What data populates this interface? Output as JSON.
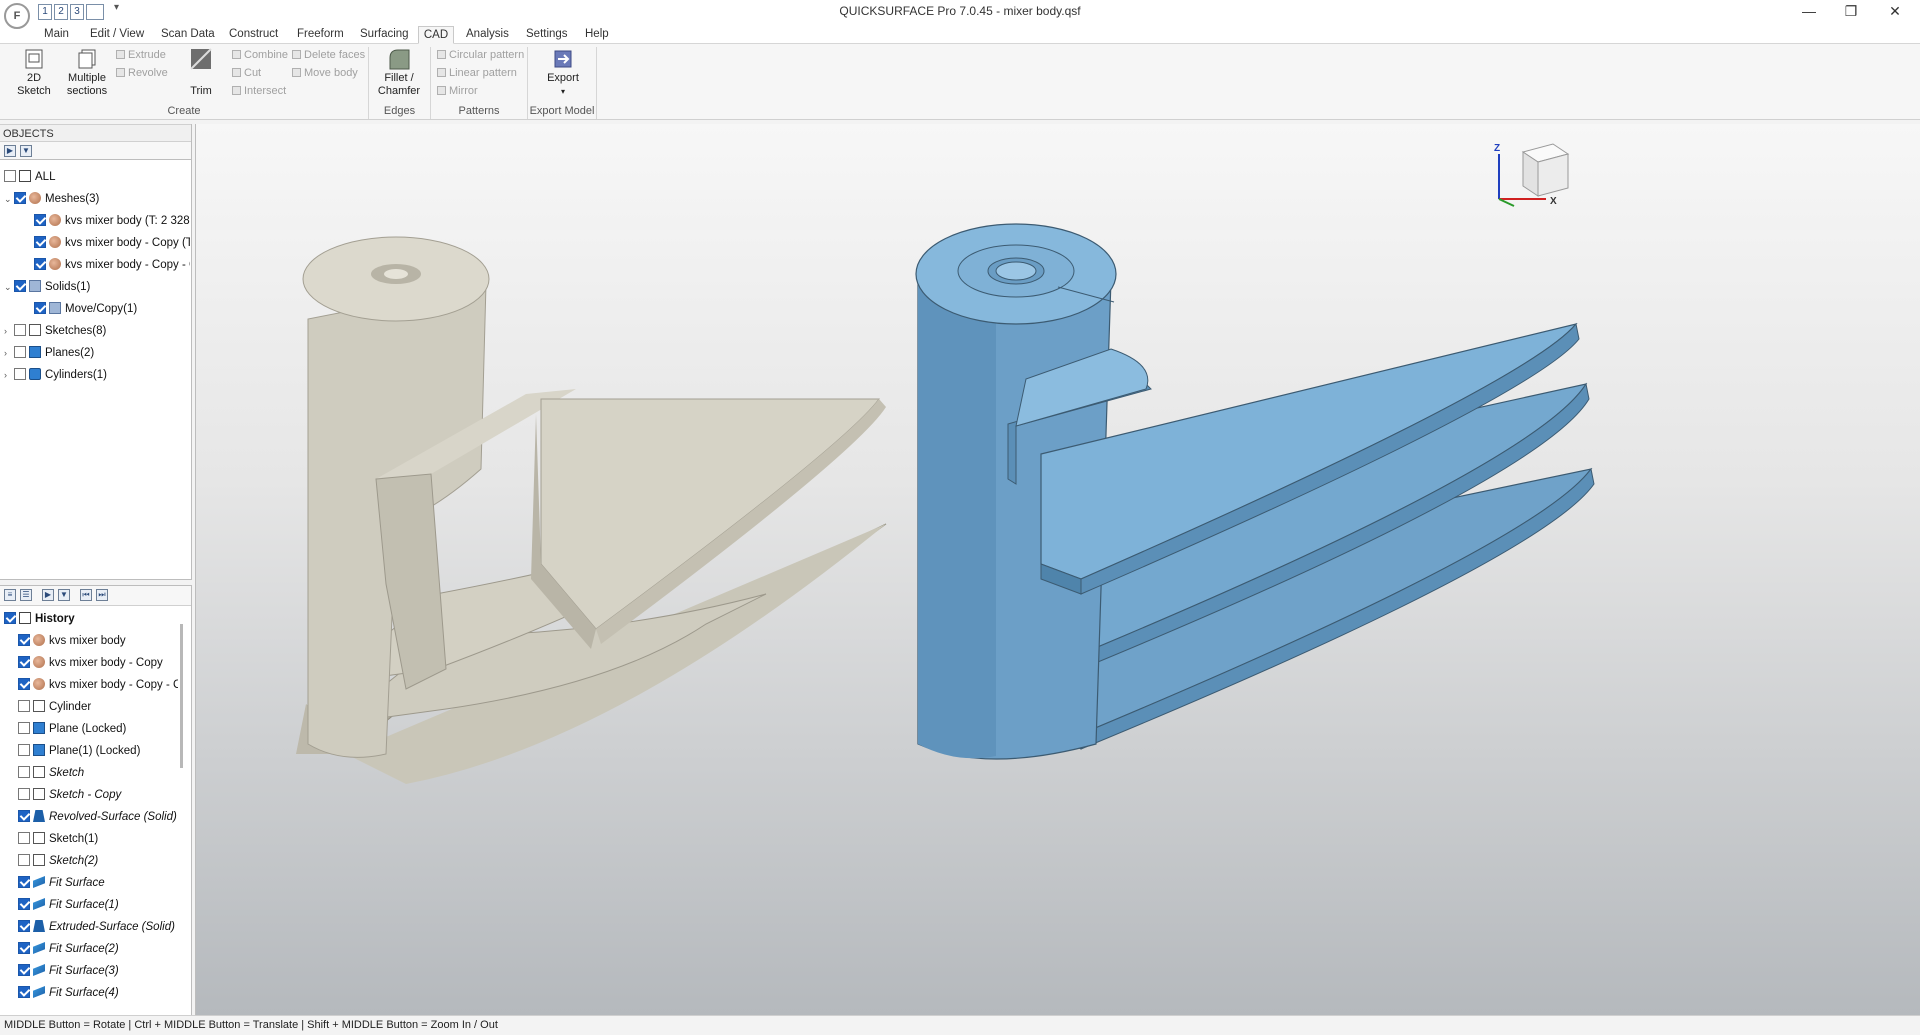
{
  "titlebar": {
    "title": "QUICKSURFACE Pro 7.0.45 - mixer body.qsf",
    "app_icon": "F",
    "qat": [
      "1",
      "2",
      "3"
    ],
    "qat_more": "▾",
    "minimize": "—",
    "maximize": "❐",
    "close": "✕"
  },
  "menu": {
    "tabs": [
      "Main",
      "Edit / View",
      "Scan Data",
      "Construct",
      "Freeform",
      "Surfacing",
      "CAD",
      "Analysis",
      "Settings",
      "Help"
    ],
    "active": "CAD"
  },
  "ribbon": {
    "sketch_2d": [
      "2D",
      "Sketch"
    ],
    "multiple_sections": [
      "Multiple",
      "sections"
    ],
    "extrude": "Extrude",
    "revolve": "Revolve",
    "trim": "Trim",
    "combine": "Combine",
    "cut": "Cut",
    "intersect": "Intersect",
    "delete_faces": "Delete faces",
    "move_body": "Move body",
    "fillet": [
      "Fillet /",
      "Chamfer"
    ],
    "circular_pattern": "Circular pattern",
    "linear_pattern": "Linear pattern",
    "mirror": "Mirror",
    "export": "Export",
    "groups": {
      "create": "Create",
      "edges": "Edges",
      "patterns": "Patterns",
      "export_model": "Export Model"
    }
  },
  "objects": {
    "header": "OBJECTS",
    "items": [
      {
        "label": "ALL"
      },
      {
        "label": "Meshes(3)"
      },
      {
        "label": "kvs mixer body (T: 2 328 1"
      },
      {
        "label": "kvs mixer body - Copy (T:"
      },
      {
        "label": "kvs mixer body - Copy - C"
      },
      {
        "label": "Solids(1)"
      },
      {
        "label": "Move/Copy(1)"
      },
      {
        "label": "Sketches(8)"
      },
      {
        "label": "Planes(2)"
      },
      {
        "label": "Cylinders(1)"
      }
    ]
  },
  "history": {
    "header": "History",
    "items": [
      {
        "label": "kvs mixer body"
      },
      {
        "label": "kvs mixer body - Copy"
      },
      {
        "label": "kvs mixer body - Copy - C"
      },
      {
        "label": "Cylinder"
      },
      {
        "label": "Plane (Locked)"
      },
      {
        "label": "Plane(1) (Locked)"
      },
      {
        "label": "Sketch"
      },
      {
        "label": "Sketch - Copy"
      },
      {
        "label": "Revolved-Surface (Solid)"
      },
      {
        "label": "Sketch(1)"
      },
      {
        "label": "Sketch(2)"
      },
      {
        "label": "Fit Surface"
      },
      {
        "label": "Fit Surface(1)"
      },
      {
        "label": "Extruded-Surface (Solid)"
      },
      {
        "label": "Fit Surface(2)"
      },
      {
        "label": "Fit Surface(3)"
      },
      {
        "label": "Fit Surface(4)"
      }
    ]
  },
  "viewport": {
    "axis_z": "Z",
    "axis_x": "X",
    "mesh_color": "#d3d0c3",
    "solid_color": "#7fb1d6"
  },
  "statusbar": {
    "text": "MIDDLE Button = Rotate | Ctrl + MIDDLE Button = Translate | Shift + MIDDLE Button = Zoom In / Out"
  }
}
